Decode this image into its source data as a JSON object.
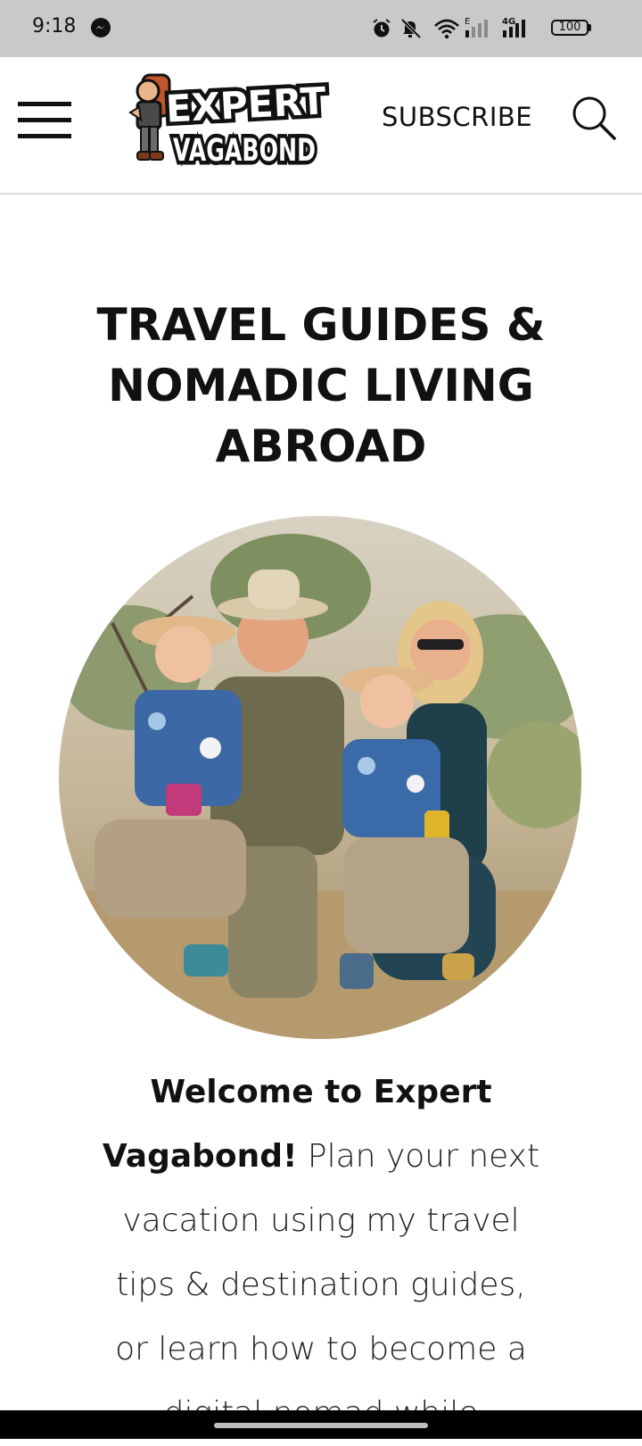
{
  "status_bar": {
    "time": "9:18",
    "battery": "100",
    "icons": [
      "messenger-icon",
      "alarm-icon",
      "mute-icon",
      "wifi-icon",
      "signal-icon",
      "4g-signal-icon",
      "battery-icon"
    ]
  },
  "header": {
    "logo_line1": "EXPERT",
    "logo_line2": "VAGABOND",
    "subscribe_label": "SUBSCRIBE"
  },
  "hero": {
    "title": "TRAVEL GUIDES & NOMADIC LIVING ABROAD"
  },
  "intro": {
    "bold_text": "Welcome to Expert Vagabond!",
    "text": " Plan your next vacation using my travel tips & destination guides, or learn how to become a digital nomad while"
  },
  "colors": {
    "status_bar_bg": "#c9c9c9",
    "text": "#111111",
    "divider": "#d9d9d9"
  }
}
